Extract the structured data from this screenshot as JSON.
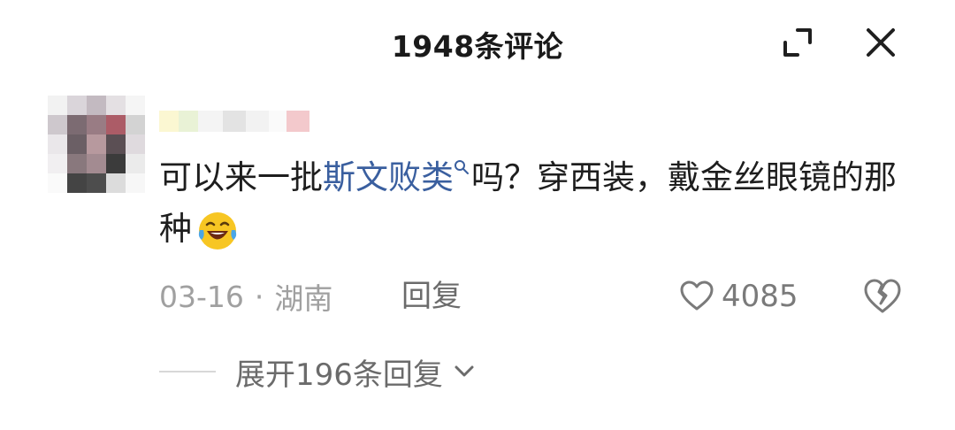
{
  "header": {
    "title": "1948条评论"
  },
  "comment": {
    "text_before": "可以来一批",
    "link_text": "斯文败类",
    "text_after": "吗？穿西装，戴金丝眼镜的那种",
    "date": "03-16",
    "separator": "·",
    "location": "湖南",
    "reply_label": "回复",
    "like_count": "4085"
  },
  "replies": {
    "expand_label": "展开196条回复"
  },
  "icons": {
    "expand": "expand-icon",
    "close": "close-icon",
    "search": "search-icon",
    "emoji": "laughing-tears-emoji",
    "like": "heart-icon",
    "dislike": "broken-heart-icon",
    "chevron": "chevron-down-icon"
  },
  "colors": {
    "link": "#3a5f9f",
    "meta": "#a0a0a0",
    "text": "#1e1e1e"
  }
}
